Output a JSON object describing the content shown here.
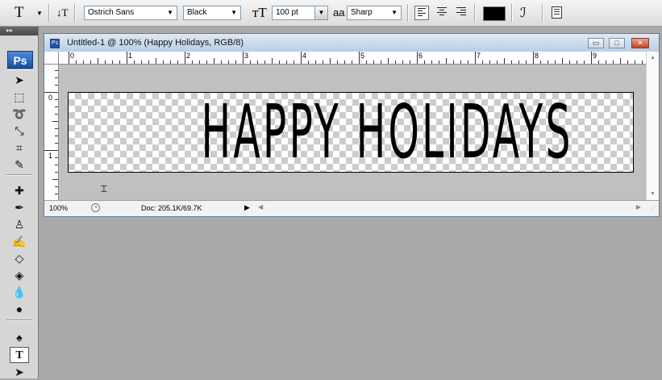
{
  "options_bar": {
    "tool_preset_glyph": "T",
    "font_family": "Ostrich Sans",
    "font_style": "Black",
    "font_size": "100 pt",
    "antialias_label": "aa",
    "antialias": "Sharp",
    "text_color": "#000000"
  },
  "tools_panel": {
    "header_glyph": "▸▸",
    "logo": "Ps"
  },
  "document": {
    "title": "Untitled-1 @ 100% (Happy Holidays, RGB/8)",
    "text_layer": "HAPPY HOLIDAYS",
    "ruler_h_numbers": [
      "0",
      "1",
      "2",
      "3",
      "4",
      "5",
      "6",
      "7",
      "8",
      "9"
    ],
    "ruler_v_numbers": [
      "0",
      "1"
    ],
    "zoom": "100%",
    "doc_info": "Doc: 205.1K/69.7K"
  }
}
